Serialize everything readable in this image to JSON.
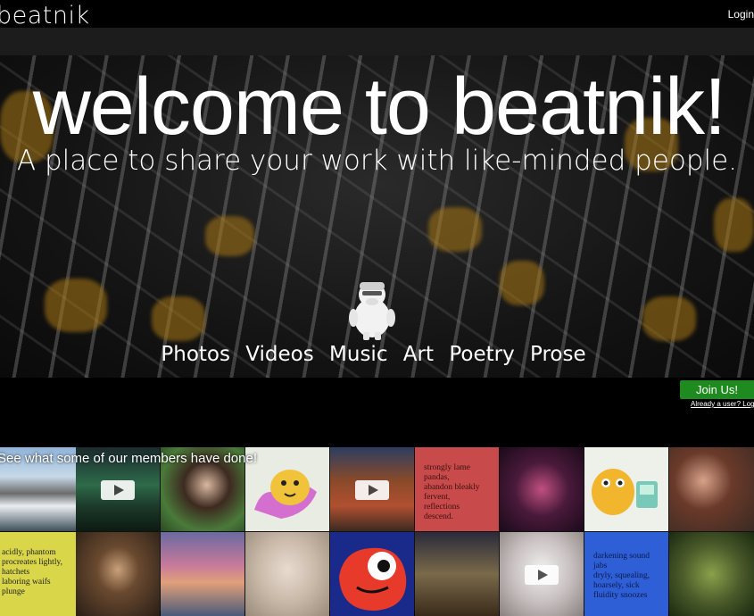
{
  "header": {
    "logo": "beatnik",
    "login": "Login"
  },
  "hero": {
    "title": "welcome to beatnik!",
    "subtitle": "A place to share your work with like-minded people.",
    "categories": [
      "Photos",
      "Videos",
      "Music",
      "Art",
      "Poetry",
      "Prose"
    ]
  },
  "cta": {
    "join_label": "Join Us!",
    "already_user": "Already a user? Login"
  },
  "gallery": {
    "title": "See what some of our members have done!",
    "poems": {
      "poem1": "strongly lame\npandas,\nabandon bleakly\nfervent,\nreflections\ndescend.",
      "poem2": "acidly, phantom\nprocreates lightly,\nhatchets\nlaboring waifs\nplunge",
      "poem3": "darkening sound\njabs\ndryly, squealing,\nhoarsely, sick\nfluidity snoozes"
    }
  },
  "colors": {
    "join_green": "#1f8a1f",
    "poem1_bg": "#c94a4a",
    "poem2_bg": "#d9d64a",
    "poem3_bg": "#2f5fd6"
  }
}
